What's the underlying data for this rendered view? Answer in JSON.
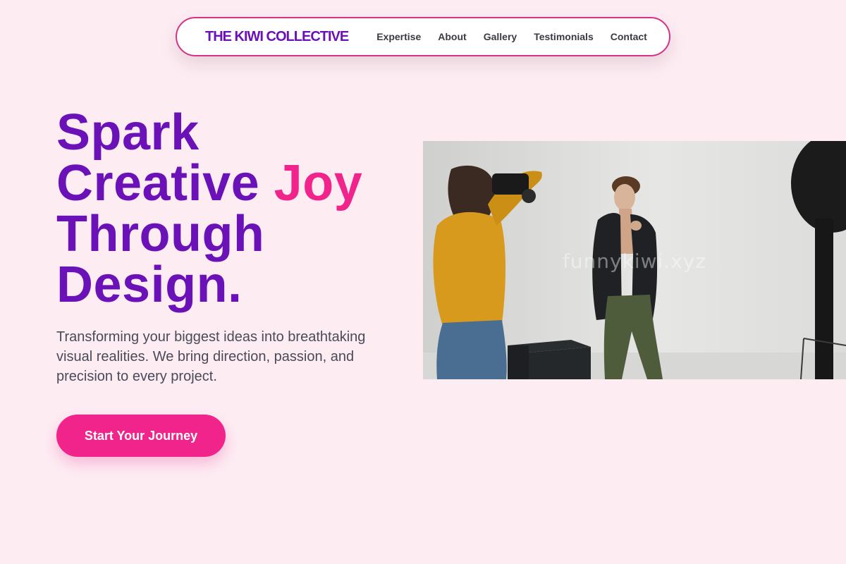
{
  "nav": {
    "brand": "THE KIWI COLLECTIVE",
    "links": [
      {
        "label": "Expertise"
      },
      {
        "label": "About"
      },
      {
        "label": "Gallery"
      },
      {
        "label": "Testimonials"
      },
      {
        "label": "Contact"
      }
    ]
  },
  "hero": {
    "headline": {
      "line1": "Spark",
      "line2_prefix": "Creative ",
      "line2_accent": "Joy",
      "line3": "Through",
      "line4": "Design."
    },
    "subtext": "Transforming your biggest ideas into breathtaking visual realities. We bring direction, passion, and precision to every project.",
    "cta_label": "Start Your Journey",
    "image": {
      "description_icon": "photo-shoot-image",
      "watermark": "funnykiwi.xyz"
    }
  },
  "colors": {
    "background": "#fdedf3",
    "primary_purple": "#6a12b8",
    "accent_pink": "#f0248a",
    "nav_border": "#d63384",
    "body_text": "#4a4a58"
  }
}
